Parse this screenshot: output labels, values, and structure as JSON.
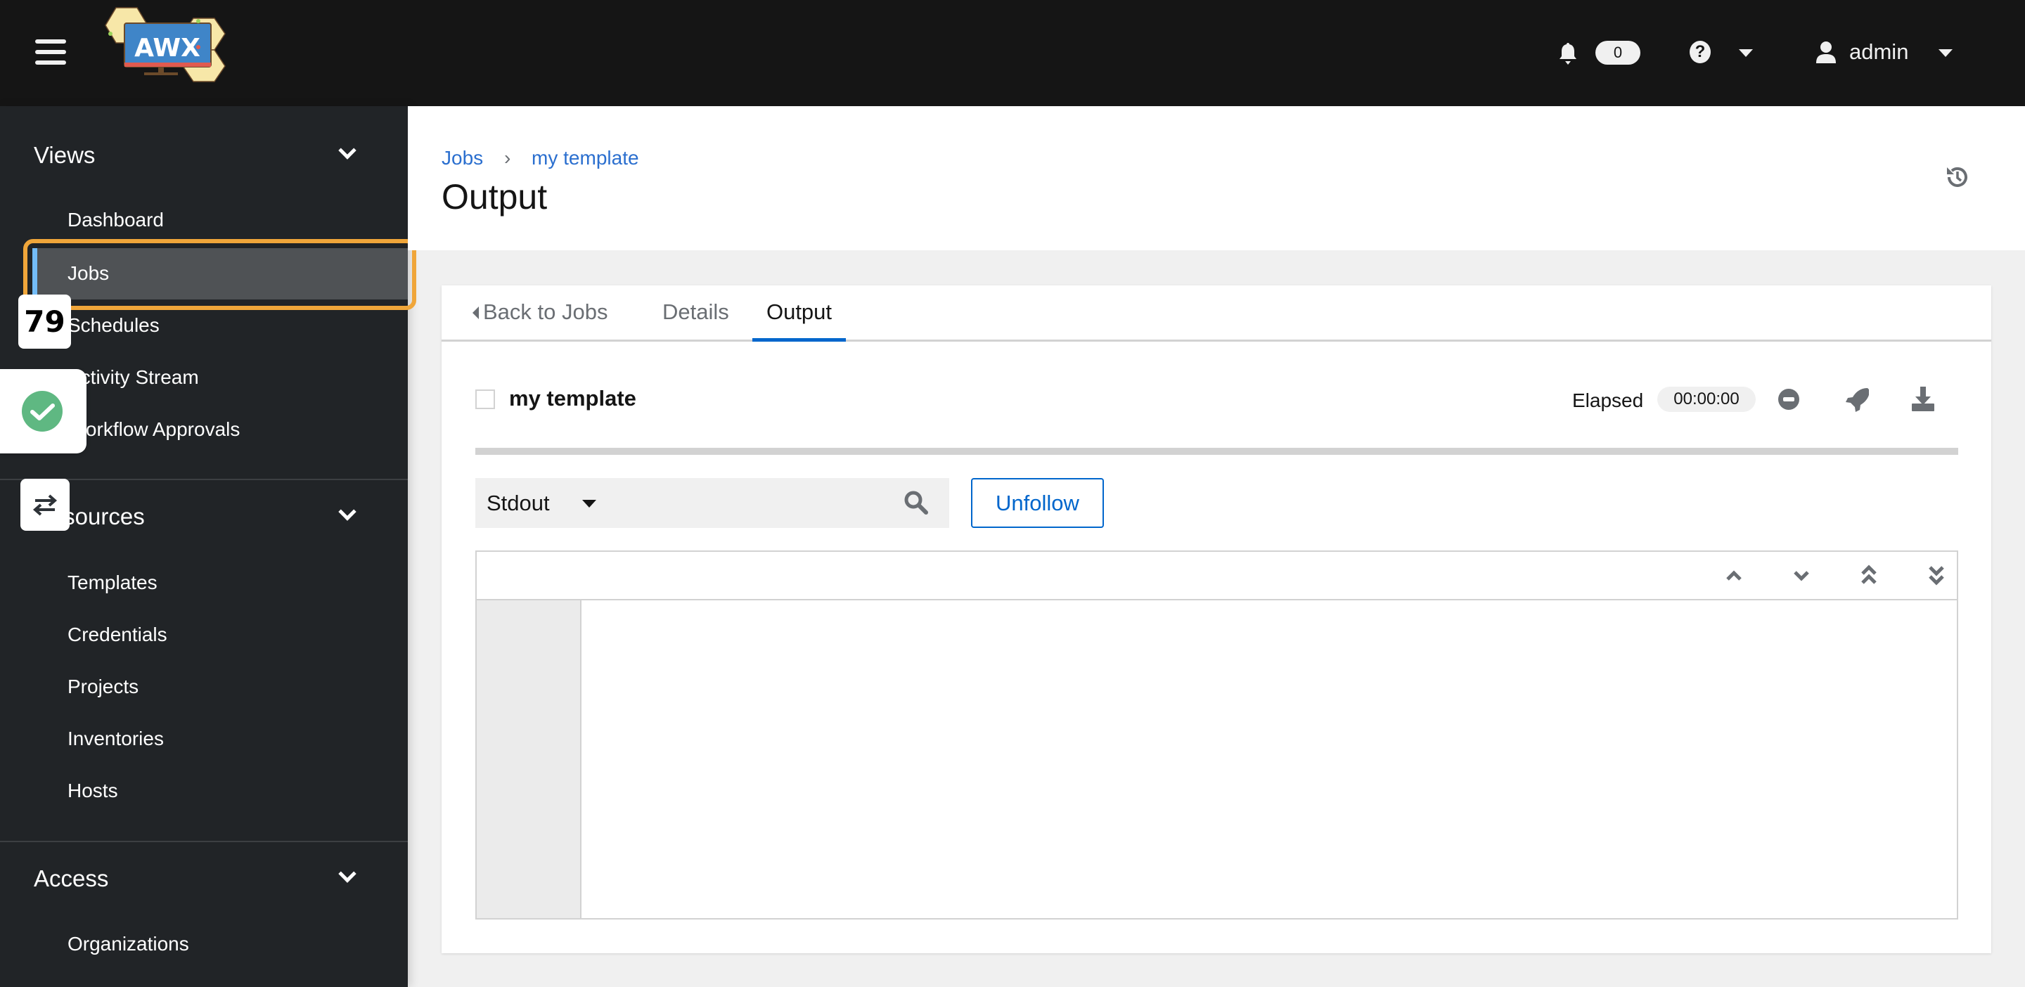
{
  "header": {
    "logo_text": "AWX",
    "notification_count": "0",
    "user": "admin"
  },
  "sidebar": {
    "groups": [
      {
        "label": "Views",
        "items": [
          "Dashboard",
          "Jobs",
          "Schedules",
          "Activity Stream",
          "Workflow Approvals"
        ]
      },
      {
        "label": "Resources",
        "items": [
          "Templates",
          "Credentials",
          "Projects",
          "Inventories",
          "Hosts"
        ]
      },
      {
        "label": "Access",
        "items": [
          "Organizations"
        ]
      }
    ],
    "active_item": "Jobs"
  },
  "overlays": {
    "counter": "79"
  },
  "page": {
    "breadcrumb": [
      "Jobs",
      "my template"
    ],
    "title": "Output"
  },
  "tabs": {
    "back": "Back to Jobs",
    "details": "Details",
    "output": "Output",
    "active": "Output"
  },
  "job": {
    "name": "my template",
    "elapsed_label": "Elapsed",
    "elapsed": "00:00:00"
  },
  "toolbar": {
    "filter_value": "Stdout",
    "unfollow": "Unfollow"
  },
  "colors": {
    "accent": "#06c",
    "link": "#2b6fcf",
    "highlight": "#f0a63a",
    "success": "#5fb882"
  }
}
